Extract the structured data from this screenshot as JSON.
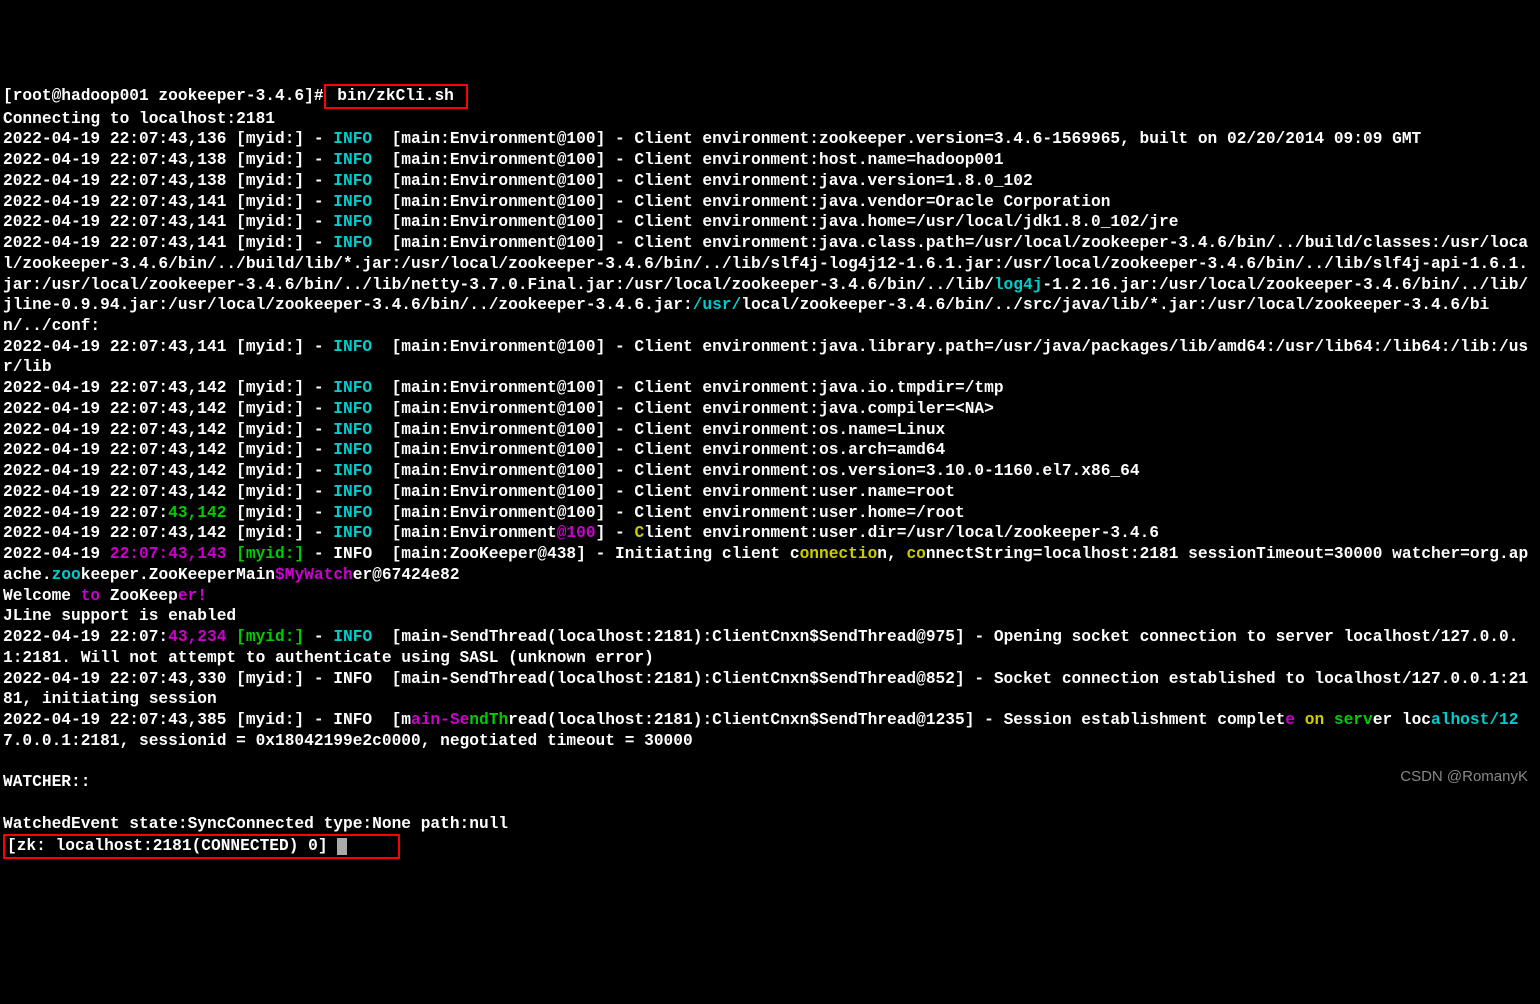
{
  "prompt": {
    "user_host": "[root@hadoop001 zookeeper-3.4.6]#",
    "command": " bin/zkCli.sh "
  },
  "connecting": "Connecting to localhost:2181",
  "l1a": "2022-04-19 22:07:43,136 [myid:] - ",
  "info": "INFO",
  "l1b": "  [main:Environment@100] - Client environment:zookeeper.version=3.4.6-1569965, built on 02/20/2014 09:09 GMT",
  "l2b": "  [main:Environment@100] - Client environment:host.name=hadoop001",
  "l3a": "2022-04-19 22:07:43,138 [myid:] - ",
  "l3b": "  [main:Environment@100] - Client environment:java.version=1.8.0_102",
  "l4a": "2022-04-19 22:07:43,141 [myid:] - ",
  "l4b": "  [main:Environment@100] - Client environment:java.vendor=Oracle Corporation",
  "l5b": "  [main:Environment@100] - Client environment:java.home=/usr/local/jdk1.8.0_102/jre",
  "l6b": "  [main:Environment@100] - Client environment:java.class.path=/usr/local/zookeeper-3.4.6/bin/../build/classes:/usr/local/zookeeper-3.4.6/bin/../build/lib/*.jar:/usr/local/zookeeper-3.4.6/bin/../lib/slf4j-log4j12-1.6.1.jar:/usr/local/zookeeper-3.4.6/bin/../lib/slf4j-api-1.6.1.jar:/usr/local/zookeeper-3.4.6/bin/../lib/netty-3.7.0.Final.jar:/usr/local/zookeeper-3.4.6/bin/../lib/",
  "l6_log4j": "log4j",
  "l6c": "-1.2.16.jar:/usr/local/zookeeper-3.4.6/bin/../lib/jline-0.9.94.jar:/usr/local/zookeeper-3.4.6/bin/../zookeeper-3.4.6.jar:",
  "l6_usr": "/usr/",
  "l6d": "local/zookeeper-3.4.6/bin/../src/java/lib/*.jar:/usr/local/zookeeper-3.4.6/bin/../conf:",
  "l7b": "  [main:Environment@100] - Client environment:java.library.path=/usr/java/packages/lib/amd64:/usr/lib64:/lib64:/lib:/usr/lib",
  "l8a": "2022-04-19 22:07:43,142 [myid:] - ",
  "l8b": "  [main:Environment@100] - Client environment:java.io.tmpdir=/tmp",
  "l9b": "  [main:Environment@100] - Client environment:java.compiler=<NA>",
  "l10b": "  [main:Environment@100] - Client environment:os.name=Linux",
  "l11b": "  [main:Environment@100] - Client environment:os.arch=amd64",
  "l12b": "  [main:Environment@100] - Client environment:os.version=3.10.0-1160.el7.x86_64",
  "l13b": "  [main:Environment@100] - Client environment:user.name=root",
  "l14a": "2022-04-19 22:07:",
  "l14_ts": "43,142",
  "l14_my": " [myid:] - ",
  "l14b": "  [main:Environment@100] - Client environment:user.home=/root",
  "l15b": "  [main:Environment",
  "l15_at": "@100",
  "l15c": "] - ",
  "l15_c": "C",
  "l15d": "lient environment:user.dir=/usr/local/zookeeper-3.4.6",
  "l16a": "2022-04-19 ",
  "l16_ts": "22:07:43,143",
  "l16_my": " [myid:]",
  "l16b": " - INFO  [main:ZooKeeper@438] - Initiating client c",
  "l16_on": "onnectio",
  "l16c": "n, ",
  "l16_co": "co",
  "l16d": "nnectString=localhost:2181 sessionTimeout=30000 watcher=org.apache.",
  "l16_zoo": "zoo",
  "l16e": "keeper.ZooKeeperMain",
  "l16_watch": "$MyWatch",
  "l16f": "er@67424e82",
  "welcome_a": "Welcome",
  "welcome_to": " to ",
  "welcome_zk": "ZooKeep",
  "welcome_er": "er!",
  "jline": "JLine support is enabled",
  "l17a": "2022-04-19 22:07:",
  "l17_ts": "43,234",
  "l17_my": " [myid:]",
  "l17b": " - ",
  "l17c": "  [main-SendThread(localhost:2181):ClientCnxn$SendThread@975] - Opening socket connection to server localhost/127.0.0.1:2181. Will not attempt to authenticate using SASL (unknown error)",
  "l18a": "2022-04-19 22:07:43,330 [myid:] - INFO  [main-SendThread(localhost:2181):ClientCnxn$SendThread@852] - Socket connection established to localhost/127.0.0.1:2181, initiating session",
  "l19a": "2022-04-19 22:07:43,385 [myid:] - INFO  [m",
  "l19_ain": "ain-Se",
  "l19_nd": "ndTh",
  "l19b": "read(localhost:2181):ClientCnxn$SendThread@1235] - Session establishment complet",
  "l19_e": "e",
  "l19_on": " on ",
  "l19_serv": "serv",
  "l19c": "er loc",
  "l19_alhost": "alhost/12",
  "l19d": "7.0.0.1:2181, sessionid = 0x18042199e2c0000, negotiated timeout = 30000",
  "watcher": "WATCHER::",
  "watched": "WatchedEvent state:SyncConnected type:None path:null",
  "zk_prompt": "[zk: localhost:2181(CONNECTED) 0] ",
  "watermark": "CSDN @RomanyK"
}
